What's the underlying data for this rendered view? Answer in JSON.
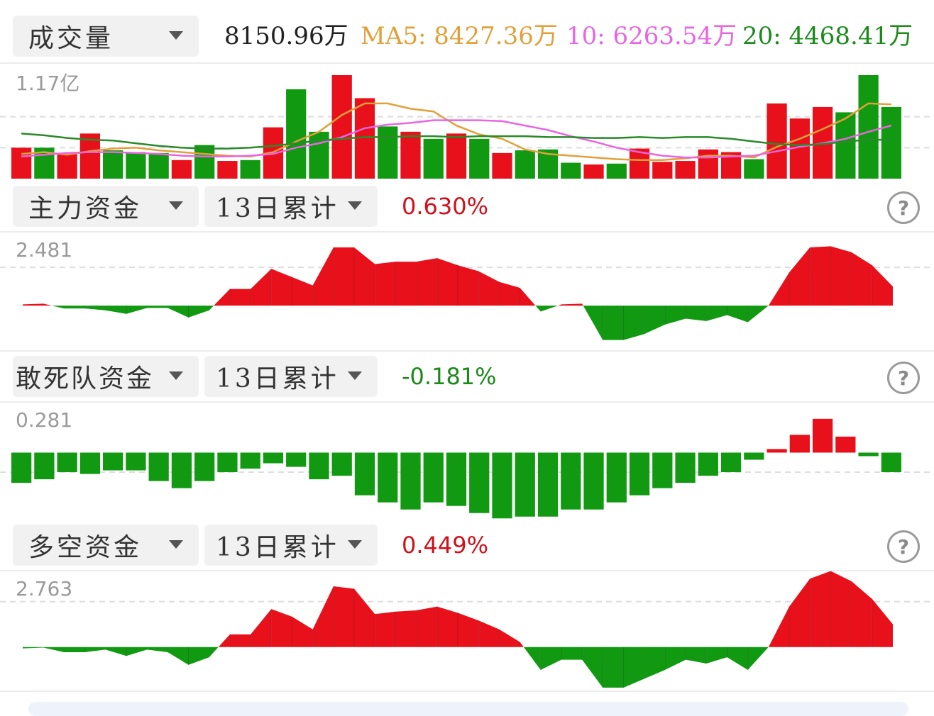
{
  "volume": {
    "selector_label": "成交量",
    "current": "8150.96万",
    "ma5_label": "MA5: 8427.36万",
    "ma10_label": "10: 6263.54万",
    "ma20_label": "20: 4468.41万",
    "axis_max_label": "1.17亿"
  },
  "main_fund": {
    "selector_label": "主力资金",
    "period_label": "13日累计",
    "value": "0.630%",
    "axis_max_label": "2.481"
  },
  "dare_fund": {
    "selector_label": "敢死队资金",
    "period_label": "13日累计",
    "value": "-0.181%",
    "axis_max_label": "0.281"
  },
  "longshort_fund": {
    "selector_label": "多空资金",
    "period_label": "13日累计",
    "value": "0.449%",
    "axis_max_label": "2.763"
  },
  "colors": {
    "up": "#e8111b",
    "down": "#119a11",
    "ma5": "#e2a03a",
    "ma10": "#e866e0",
    "ma20": "#2a8a2a",
    "value_up": "#d0111b",
    "value_down": "#1a8a1a"
  },
  "chart_data": [
    {
      "type": "bar",
      "ylim": [
        0,
        1.17
      ],
      "unit": "亿",
      "values": [
        0.35,
        0.35,
        0.28,
        0.51,
        0.32,
        0.3,
        0.29,
        0.21,
        0.38,
        0.2,
        0.21,
        0.58,
        1.01,
        0.53,
        1.17,
        0.91,
        0.59,
        0.53,
        0.45,
        0.51,
        0.45,
        0.29,
        0.32,
        0.33,
        0.18,
        0.16,
        0.17,
        0.34,
        0.19,
        0.2,
        0.33,
        0.3,
        0.22,
        0.85,
        0.68,
        0.81,
        0.75,
        1.17,
        0.81
      ],
      "up": [
        1,
        0,
        1,
        1,
        0,
        0,
        0,
        1,
        0,
        1,
        0,
        1,
        0,
        0,
        1,
        1,
        0,
        1,
        0,
        1,
        0,
        1,
        0,
        0,
        0,
        1,
        0,
        1,
        1,
        1,
        1,
        1,
        0,
        1,
        1,
        1,
        0,
        0,
        0
      ],
      "series": [
        {
          "values": [
            0.28,
            0.3,
            0.27,
            0.31,
            0.34,
            0.35,
            0.32,
            0.3,
            0.28,
            0.26,
            0.25,
            0.3,
            0.42,
            0.53,
            0.72,
            0.85,
            0.85,
            0.79,
            0.76,
            0.6,
            0.5,
            0.45,
            0.33,
            0.28,
            0.26,
            0.24,
            0.22,
            0.21,
            0.21,
            0.23,
            0.26,
            0.26,
            0.24,
            0.36,
            0.45,
            0.56,
            0.68,
            0.85,
            0.84
          ]
        },
        {
          "values": [
            0.25,
            0.27,
            0.29,
            0.3,
            0.3,
            0.29,
            0.28,
            0.26,
            0.25,
            0.25,
            0.26,
            0.28,
            0.35,
            0.4,
            0.47,
            0.57,
            0.61,
            0.63,
            0.66,
            0.66,
            0.66,
            0.65,
            0.6,
            0.55,
            0.48,
            0.42,
            0.35,
            0.3,
            0.26,
            0.24,
            0.24,
            0.25,
            0.26,
            0.31,
            0.36,
            0.4,
            0.45,
            0.53,
            0.6
          ]
        },
        {
          "values": [
            0.51,
            0.49,
            0.46,
            0.44,
            0.43,
            0.4,
            0.37,
            0.35,
            0.34,
            0.34,
            0.35,
            0.37,
            0.4,
            0.43,
            0.45,
            0.47,
            0.47,
            0.48,
            0.48,
            0.47,
            0.48,
            0.48,
            0.48,
            0.47,
            0.47,
            0.46,
            0.46,
            0.47,
            0.46,
            0.47,
            0.47,
            0.45,
            0.42,
            0.39,
            0.38,
            0.39,
            0.42,
            0.44,
            0.44
          ]
        }
      ]
    },
    {
      "type": "area",
      "ylim": [
        -1.7,
        2.481
      ],
      "values": [
        0.05,
        0.08,
        -0.12,
        -0.12,
        -0.2,
        -0.35,
        -0.1,
        -0.1,
        -0.5,
        -0.2,
        0.7,
        0.7,
        1.55,
        1.2,
        0.85,
        2.45,
        2.45,
        1.75,
        1.85,
        1.85,
        2.0,
        1.7,
        1.45,
        1.0,
        0.75,
        -0.25,
        0.05,
        0.08,
        -1.45,
        -1.45,
        -1.2,
        -0.8,
        -0.55,
        -0.65,
        -0.4,
        -0.7,
        0.0,
        1.4,
        2.45,
        2.5,
        2.25,
        1.7,
        0.8
      ]
    },
    {
      "type": "bar",
      "ylim": [
        -0.381,
        0.281
      ],
      "values": [
        -0.17,
        -0.15,
        -0.11,
        -0.12,
        -0.1,
        -0.1,
        -0.16,
        -0.2,
        -0.16,
        -0.11,
        -0.09,
        -0.06,
        -0.08,
        -0.15,
        -0.13,
        -0.24,
        -0.28,
        -0.32,
        -0.28,
        -0.3,
        -0.34,
        -0.37,
        -0.36,
        -0.36,
        -0.32,
        -0.32,
        -0.28,
        -0.24,
        -0.2,
        -0.17,
        -0.13,
        -0.11,
        -0.04,
        0.02,
        0.1,
        0.19,
        0.09,
        -0.02,
        -0.11
      ],
      "up": [
        0,
        0,
        0,
        0,
        0,
        0,
        0,
        0,
        0,
        0,
        0,
        0,
        0,
        0,
        0,
        0,
        0,
        0,
        0,
        0,
        0,
        0,
        0,
        0,
        0,
        0,
        0,
        0,
        0,
        0,
        0,
        0,
        0,
        1,
        1,
        1,
        1,
        0,
        0
      ]
    },
    {
      "type": "area",
      "ylim": [
        -1.6,
        2.763
      ],
      "values": [
        -0.05,
        -0.02,
        -0.2,
        -0.2,
        -0.1,
        -0.35,
        -0.1,
        -0.2,
        -0.7,
        -0.4,
        0.5,
        0.5,
        1.5,
        1.2,
        0.7,
        2.4,
        2.3,
        1.3,
        1.4,
        1.45,
        1.6,
        1.35,
        1.05,
        0.7,
        0.2,
        -0.9,
        -0.5,
        -0.5,
        -1.6,
        -1.6,
        -1.25,
        -0.9,
        -0.5,
        -0.65,
        -0.4,
        -0.9,
        0.0,
        1.6,
        2.7,
        3.0,
        2.6,
        1.9,
        0.9
      ]
    }
  ]
}
